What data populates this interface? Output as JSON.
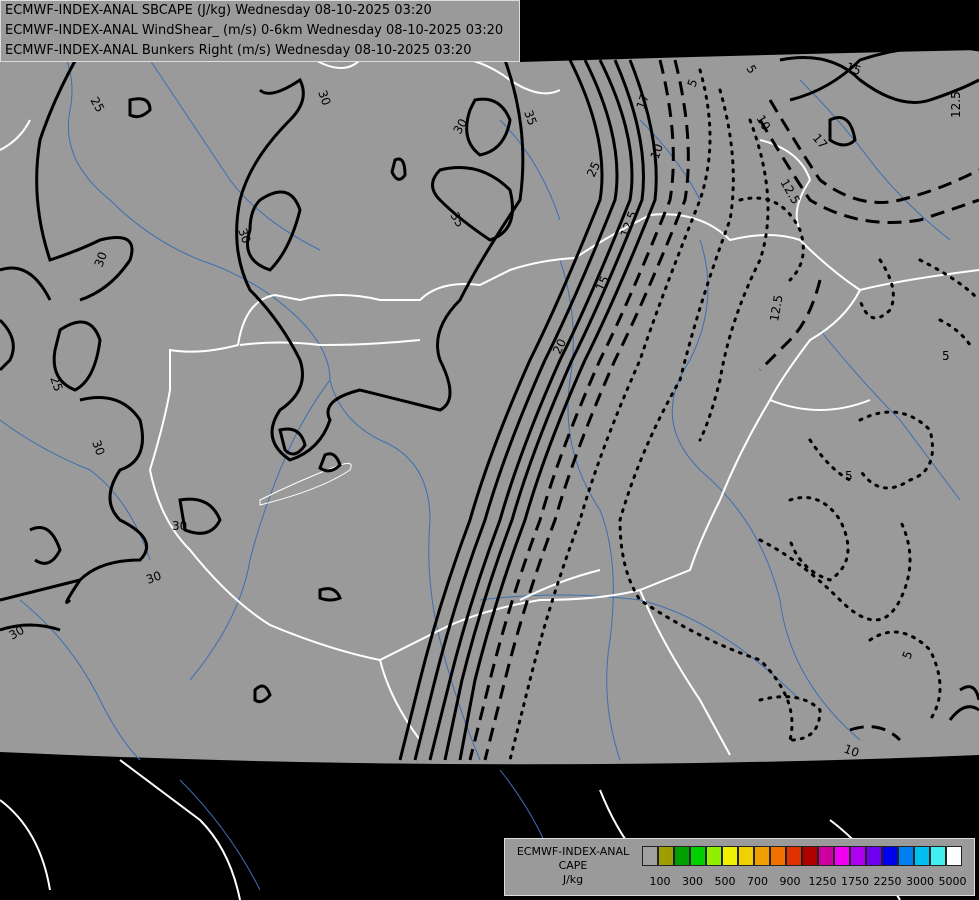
{
  "header": {
    "line1": "ECMWF-INDEX-ANAL SBCAPE (J/kg) Wednesday 08-10-2025 03:20",
    "line2": "ECMWF-INDEX-ANAL WindShear_ (m/s) 0-6km Wednesday 08-10-2025 03:20",
    "line3": "ECMWF-INDEX-ANAL Bunkers Right (m/s) Wednesday 08-10-2025 03:20"
  },
  "legend": {
    "title1": "ECMWF-INDEX-ANAL",
    "title2": "CAPE",
    "title3": "J/kg",
    "colors": [
      "#a0a0a0",
      "#9e9e00",
      "#00a000",
      "#00d000",
      "#90f000",
      "#f0f000",
      "#f0d000",
      "#f0a000",
      "#f07000",
      "#e03000",
      "#b00000",
      "#d000a0",
      "#f000f0",
      "#b000f0",
      "#7000f0",
      "#0000f0",
      "#0080f0",
      "#00c0f0",
      "#40f0f0",
      "#ffffff"
    ],
    "ticks": [
      "100",
      "300",
      "500",
      "700",
      "900",
      "1250",
      "1750",
      "2250",
      "3000",
      "5000"
    ]
  },
  "contour_labels": {
    "solid": [
      "25",
      "30",
      "30",
      "35",
      "35",
      "30",
      "30",
      "25",
      "30",
      "30",
      "30",
      "30",
      "25",
      "20",
      "15",
      "17"
    ],
    "dashed": [
      "12.5",
      "12.5",
      "12.5",
      "10",
      "10",
      "10",
      "15",
      "12.5",
      "17"
    ],
    "dotted": [
      "5",
      "5",
      "5",
      "5",
      "5"
    ]
  }
}
